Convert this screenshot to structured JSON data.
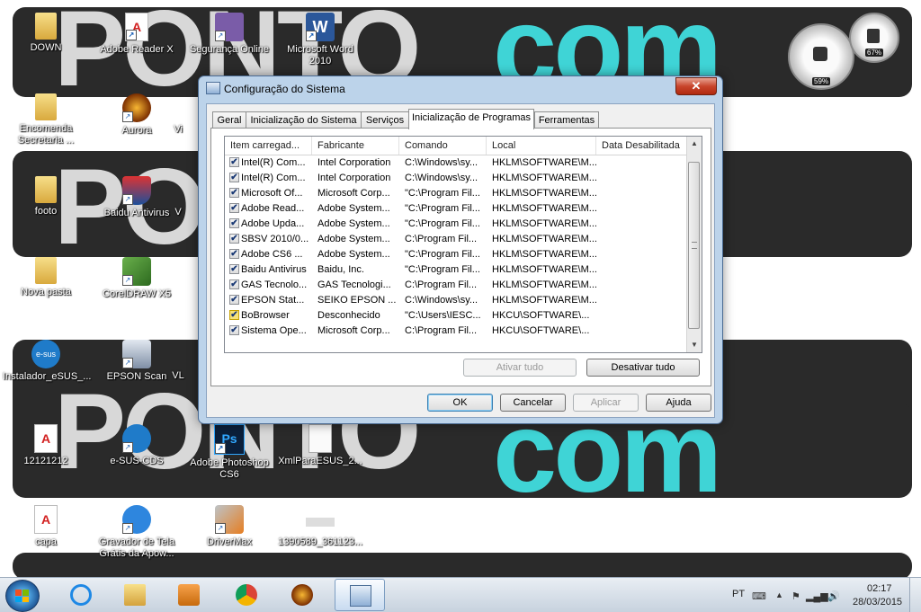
{
  "wallpaper": {
    "brand_left": "PONTO",
    "brand_right": "com"
  },
  "desktop_icons": [
    {
      "label": "DOWN"
    },
    {
      "label": "Adobe Reader X"
    },
    {
      "label": "Segurança Online"
    },
    {
      "label": "Microsoft Word 2010"
    },
    {
      "label": "Encomenda Secretaria ..."
    },
    {
      "label": "Aurora"
    },
    {
      "label": "Vi"
    },
    {
      "label": "footo"
    },
    {
      "label": "Baidu Antivirus"
    },
    {
      "label": "V"
    },
    {
      "label": "Nova pasta"
    },
    {
      "label": "CorelDRAW X5"
    },
    {
      "label": "Instalador_eSUS_..."
    },
    {
      "label": "EPSON Scan"
    },
    {
      "label": "VL"
    },
    {
      "label": "12121212"
    },
    {
      "label": "e-SUS-CDS"
    },
    {
      "label": "Adobe Photoshop CS6"
    },
    {
      "label": "XmlParaESUS_2..."
    },
    {
      "label": "capa"
    },
    {
      "label": "Gravador de Tela Grátis da Apow..."
    },
    {
      "label": "DriverMax"
    },
    {
      "label": "1390589_361123..."
    }
  ],
  "gadget": {
    "cpu": "59%",
    "memory": "67%"
  },
  "dialog": {
    "title": "Configuração do Sistema",
    "close_label": "✕",
    "tabs": [
      {
        "label": "Geral"
      },
      {
        "label": "Inicialização do Sistema"
      },
      {
        "label": "Serviços"
      },
      {
        "label": "Inicialização de Programas"
      },
      {
        "label": "Ferramentas"
      }
    ],
    "columns": [
      "Item carregad...",
      "Fabricante",
      "Comando",
      "Local",
      "Data Desabilitada"
    ],
    "rows": [
      {
        "checked": "✔",
        "item": "Intel(R) Com...",
        "maker": "Intel Corporation",
        "command": "C:\\Windows\\sy...",
        "location": "HKLM\\SOFTWARE\\M...",
        "date": ""
      },
      {
        "checked": "✔",
        "item": "Intel(R) Com...",
        "maker": "Intel Corporation",
        "command": "C:\\Windows\\sy...",
        "location": "HKLM\\SOFTWARE\\M...",
        "date": ""
      },
      {
        "checked": "✔",
        "item": "Microsoft Of...",
        "maker": "Microsoft Corp...",
        "command": "\"C:\\Program Fil...",
        "location": "HKLM\\SOFTWARE\\M...",
        "date": ""
      },
      {
        "checked": "✔",
        "item": "Adobe Read...",
        "maker": "Adobe System...",
        "command": "\"C:\\Program Fil...",
        "location": "HKLM\\SOFTWARE\\M...",
        "date": ""
      },
      {
        "checked": "✔",
        "item": "Adobe Upda...",
        "maker": "Adobe System...",
        "command": "\"C:\\Program Fil...",
        "location": "HKLM\\SOFTWARE\\M...",
        "date": ""
      },
      {
        "checked": "✔",
        "item": "SBSV 2010/0...",
        "maker": "Adobe System...",
        "command": "C:\\Program Fil...",
        "location": "HKLM\\SOFTWARE\\M...",
        "date": ""
      },
      {
        "checked": "✔",
        "item": "Adobe CS6 ...",
        "maker": "Adobe System...",
        "command": "\"C:\\Program Fil...",
        "location": "HKLM\\SOFTWARE\\M...",
        "date": ""
      },
      {
        "checked": "✔",
        "item": "Baidu Antivirus",
        "maker": "Baidu, Inc.",
        "command": "\"C:\\Program Fil...",
        "location": "HKLM\\SOFTWARE\\M...",
        "date": ""
      },
      {
        "checked": "✔",
        "item": "GAS Tecnolo...",
        "maker": "GAS Tecnologi...",
        "command": "C:\\Program Fil...",
        "location": "HKLM\\SOFTWARE\\M...",
        "date": ""
      },
      {
        "checked": "✔",
        "item": "EPSON Stat...",
        "maker": "SEIKO EPSON ...",
        "command": "C:\\Windows\\sy...",
        "location": "HKLM\\SOFTWARE\\M...",
        "date": ""
      },
      {
        "checked": "✔",
        "item": "BoBrowser",
        "maker": "Desconhecido",
        "command": "\"C:\\Users\\IESC...",
        "location": "HKCU\\SOFTWARE\\...",
        "date": ""
      },
      {
        "checked": "✔",
        "item": "Sistema Ope...",
        "maker": "Microsoft Corp...",
        "command": "C:\\Program Fil...",
        "location": "HKCU\\SOFTWARE\\...",
        "date": ""
      }
    ],
    "buttons": {
      "enable_all": "Ativar tudo",
      "disable_all": "Desativar tudo",
      "ok": "OK",
      "cancel": "Cancelar",
      "apply": "Aplicar",
      "help": "Ajuda"
    }
  },
  "taskbar": {
    "language": "PT",
    "time": "02:17",
    "date": "28/03/2015"
  },
  "colors": {
    "wallpaper_accent": "#3fd4d6",
    "dialog_frame": "#bcd3ea",
    "close_button": "#c8452c"
  }
}
